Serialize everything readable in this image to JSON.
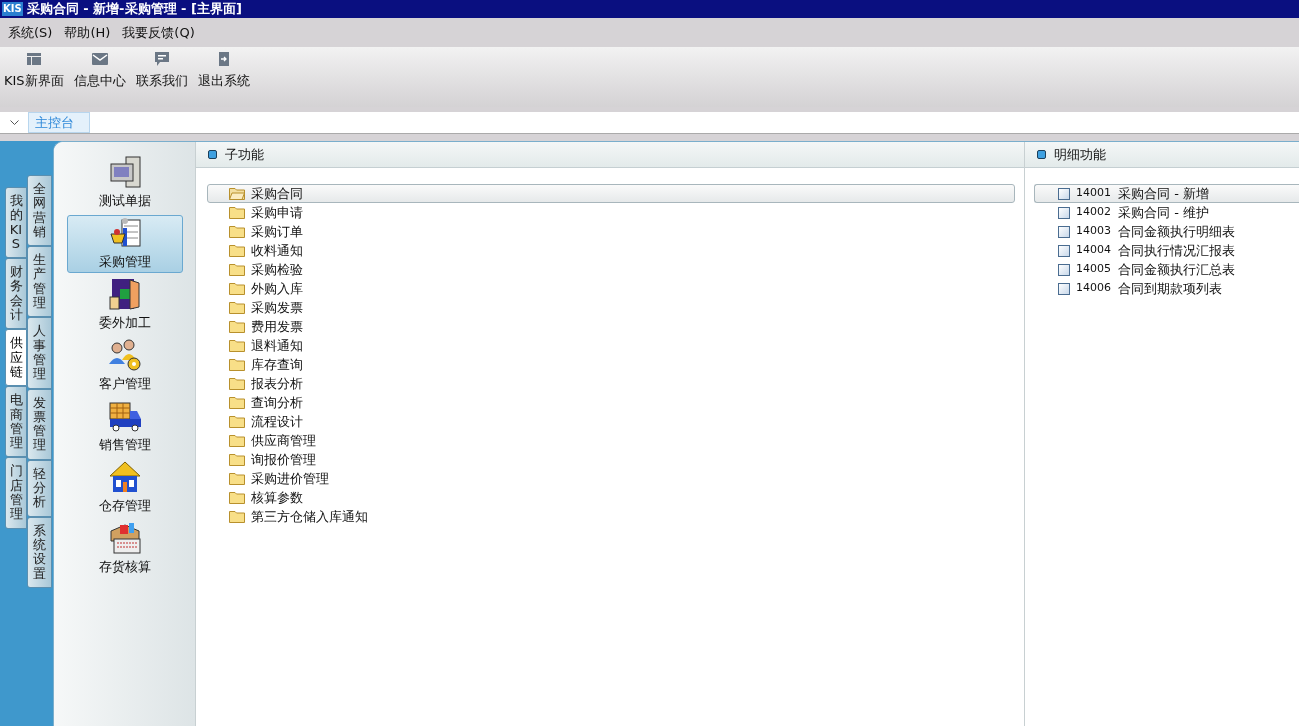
{
  "window": {
    "title": "采购合同 - 新增-采购管理 - [主界面]",
    "logo": "KIS"
  },
  "menu": [
    "系统(S)",
    "帮助(H)",
    "我要反馈(Q)"
  ],
  "toolbar": [
    {
      "label": "KIS新界面",
      "kind": "layout"
    },
    {
      "label": "信息中心",
      "kind": "mail"
    },
    {
      "label": "联系我们",
      "kind": "chat"
    },
    {
      "label": "退出系统",
      "kind": "exit"
    }
  ],
  "doc_tabs": [
    {
      "label": "主控台",
      "selected": true
    }
  ],
  "side_tabs_outer": [
    {
      "label": "我的KIS",
      "selected": false
    },
    {
      "label": "财务会计",
      "selected": false
    },
    {
      "label": "供应链",
      "selected": true
    },
    {
      "label": "电商管理",
      "selected": false
    },
    {
      "label": "门店管理",
      "selected": false
    }
  ],
  "side_tabs_inner": [
    {
      "label": "全网营销",
      "selected": false
    },
    {
      "label": "生产管理",
      "selected": false
    },
    {
      "label": "人事管理",
      "selected": false
    },
    {
      "label": "发票管理",
      "selected": false
    },
    {
      "label": "轻分析",
      "selected": false
    },
    {
      "label": "系统设置",
      "selected": false
    }
  ],
  "modules": [
    {
      "label": "测试单据",
      "kind": "monitor",
      "selected": false
    },
    {
      "label": "采购管理",
      "kind": "purchase",
      "selected": true
    },
    {
      "label": "委外加工",
      "kind": "door",
      "selected": false
    },
    {
      "label": "客户管理",
      "kind": "people",
      "selected": false
    },
    {
      "label": "销售管理",
      "kind": "truck",
      "selected": false
    },
    {
      "label": "仓存管理",
      "kind": "house",
      "selected": false
    },
    {
      "label": "存货核算",
      "kind": "register",
      "selected": false
    }
  ],
  "sub_panel": {
    "title": "子功能",
    "items": [
      {
        "label": "采购合同",
        "selected": true
      },
      {
        "label": "采购申请",
        "selected": false
      },
      {
        "label": "采购订单",
        "selected": false
      },
      {
        "label": "收料通知",
        "selected": false
      },
      {
        "label": "采购检验",
        "selected": false
      },
      {
        "label": "外购入库",
        "selected": false
      },
      {
        "label": "采购发票",
        "selected": false
      },
      {
        "label": "费用发票",
        "selected": false
      },
      {
        "label": "退料通知",
        "selected": false
      },
      {
        "label": "库存查询",
        "selected": false
      },
      {
        "label": "报表分析",
        "selected": false
      },
      {
        "label": "查询分析",
        "selected": false
      },
      {
        "label": "流程设计",
        "selected": false
      },
      {
        "label": "供应商管理",
        "selected": false
      },
      {
        "label": "询报价管理",
        "selected": false
      },
      {
        "label": "采购进价管理",
        "selected": false
      },
      {
        "label": "核算参数",
        "selected": false
      },
      {
        "label": "第三方仓储入库通知",
        "selected": false
      }
    ]
  },
  "detail_panel": {
    "title": "明细功能",
    "items": [
      {
        "code": "14001",
        "label": "采购合同 - 新增",
        "selected": true
      },
      {
        "code": "14002",
        "label": "采购合同 - 维护",
        "selected": false
      },
      {
        "code": "14003",
        "label": "合同金额执行明细表",
        "selected": false
      },
      {
        "code": "14004",
        "label": "合同执行情况汇报表",
        "selected": false
      },
      {
        "code": "14005",
        "label": "合同金额执行汇总表",
        "selected": false
      },
      {
        "code": "14006",
        "label": "合同到期款项列表",
        "selected": false
      }
    ]
  }
}
